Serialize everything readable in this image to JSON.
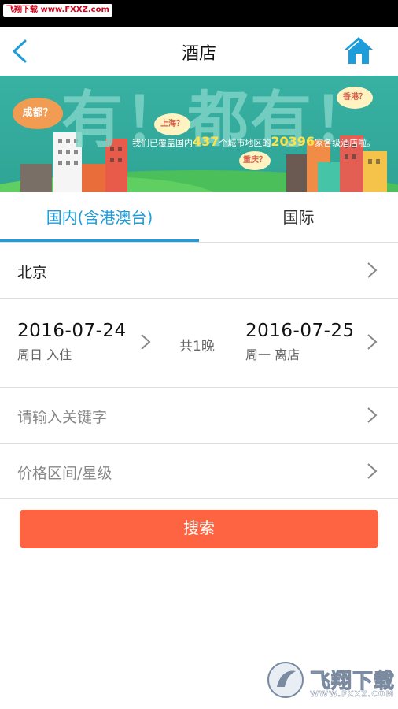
{
  "watermark": {
    "top_text": "飞翔下载 www.FXXZ.com",
    "logo_text": "飞翔下载",
    "logo_url": "WWW.FXXZ.COM"
  },
  "nav": {
    "title": "酒店"
  },
  "banner": {
    "big_text": "有！都有！",
    "text_prefix": "我们已覆盖国内",
    "city_count": "437",
    "text_middle": "个城市地区的",
    "hotel_count": "20396",
    "text_suffix": "家各级酒店啦。",
    "cities": [
      "成都？",
      "上海？",
      "香港？",
      "重庆？"
    ]
  },
  "tabs": [
    {
      "label": "国内(含港澳台)",
      "active": true
    },
    {
      "label": "国际",
      "active": false
    }
  ],
  "city": {
    "value": "北京"
  },
  "dates": {
    "checkin_date": "2016-07-24",
    "checkin_label": "周日 入住",
    "nights": "共1晚",
    "checkout_date": "2016-07-25",
    "checkout_label": "周一 离店"
  },
  "keyword": {
    "placeholder": "请输入关键字"
  },
  "price": {
    "placeholder": "价格区间/星级"
  },
  "search": {
    "label": "搜索"
  },
  "colors": {
    "accent": "#1e9ddb",
    "button": "#fe6442",
    "divider": "#dedede"
  }
}
